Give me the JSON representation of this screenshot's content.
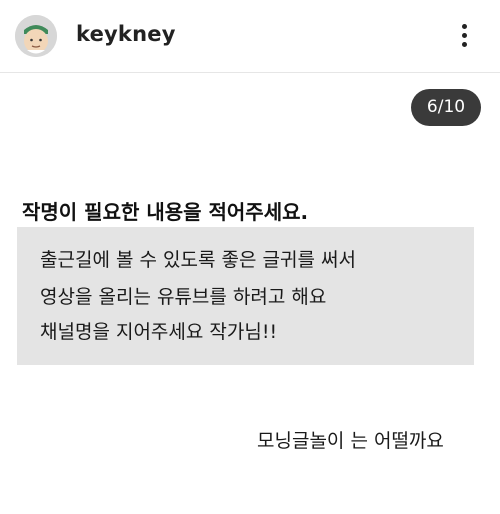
{
  "header": {
    "username": "keykney",
    "avatar_icon": "cartoon-face-avatar",
    "menu_icon": "more-vertical-icon"
  },
  "pager": {
    "text": "6/10"
  },
  "post": {
    "heading": "작명이 필요한 내용을 적어주세요.",
    "request_lines": [
      "출근길에 볼 수 있도록 좋은 글귀를 써서",
      "영상을 올리는 유튜브를 하려고 해요",
      "채널명을 지어주세요 작가님!!"
    ],
    "reply": "모닝글놀이 는 어떨까요"
  }
}
